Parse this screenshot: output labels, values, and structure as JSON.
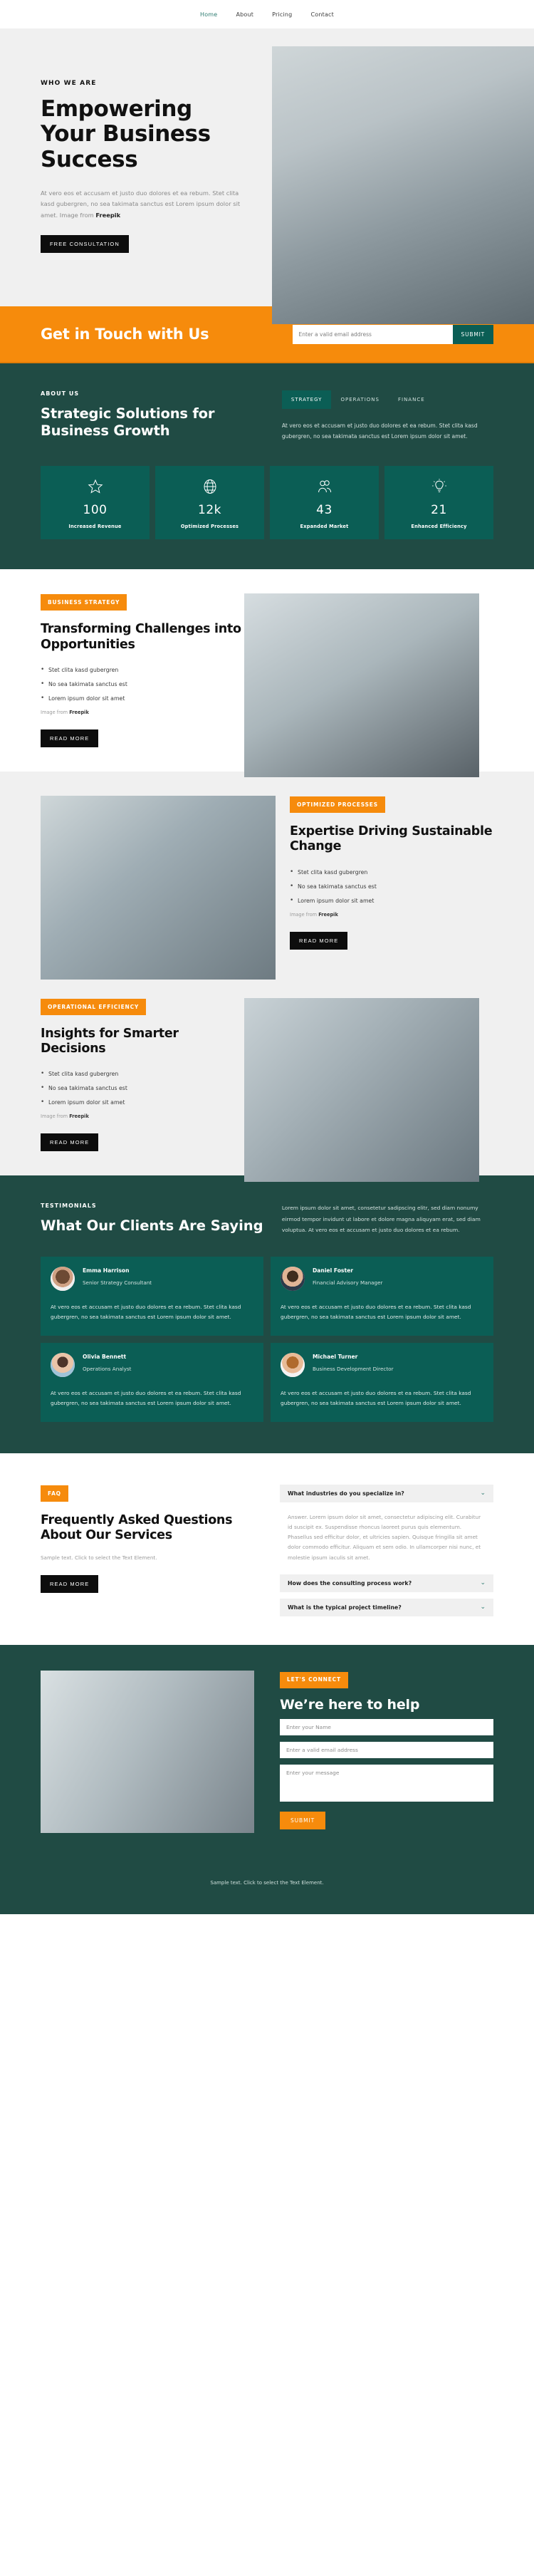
{
  "nav": {
    "items": [
      {
        "label": "Home",
        "active": true
      },
      {
        "label": "About",
        "active": false
      },
      {
        "label": "Pricing",
        "active": false
      },
      {
        "label": "Contact",
        "active": false
      }
    ]
  },
  "hero": {
    "eyebrow": "WHO WE ARE",
    "title": "Empowering Your Business Success",
    "paragraph": "At vero eos et accusam et justo duo dolores et ea rebum. Stet clita kasd gubergren, no sea takimata sanctus est Lorem ipsum dolor sit amet. Image from ",
    "paragraph_bold": "Freepik",
    "button": "FREE CONSULTATION"
  },
  "cta": {
    "heading": "Get in Touch with Us",
    "email_placeholder": "Enter a valid email address",
    "submit": "SUBMIT"
  },
  "about": {
    "eyebrow": "ABOUT US",
    "title": "Strategic Solutions for Business Growth",
    "tabs": [
      {
        "label": "STRATEGY",
        "active": true
      },
      {
        "label": "OPERATIONS",
        "active": false
      },
      {
        "label": "FINANCE",
        "active": false
      }
    ],
    "paragraph": "At vero eos et accusam et justo duo dolores et ea rebum. Stet clita kasd gubergren, no sea takimata sanctus est Lorem ipsum dolor sit amet.",
    "stats": [
      {
        "icon": "star-icon",
        "value": "100",
        "label": "Increased Revenue"
      },
      {
        "icon": "globe-icon",
        "value": "12k",
        "label": "Optimized Processes"
      },
      {
        "icon": "users-icon",
        "value": "43",
        "label": "Expanded Market"
      },
      {
        "icon": "lightbulb-icon",
        "value": "21",
        "label": "Enhanced Efficiency"
      }
    ]
  },
  "features": [
    {
      "badge": "BUSINESS STRATEGY",
      "title": "Transforming Challenges into Opportunities",
      "bullets": [
        "Stet clita kasd gubergren",
        "No sea takimata sanctus est",
        "Lorem ipsum dolor sit amet"
      ],
      "credit_prefix": "Image from ",
      "credit_bold": "Freepik",
      "button": "READ MORE"
    },
    {
      "badge": "OPTIMIZED PROCESSES",
      "title": "Expertise Driving Sustainable Change",
      "bullets": [
        "Stet clita kasd gubergren",
        "No sea takimata sanctus est",
        "Lorem ipsum dolor sit amet"
      ],
      "credit_prefix": "Image from ",
      "credit_bold": "Freepik",
      "button": "READ MORE"
    },
    {
      "badge": "OPERATIONAL EFFICIENCY",
      "title": "Insights for Smarter Decisions",
      "bullets": [
        "Stet clita kasd gubergren",
        "No sea takimata sanctus est",
        "Lorem ipsum dolor sit amet"
      ],
      "credit_prefix": "Image from ",
      "credit_bold": "Freepik",
      "button": "READ MORE"
    }
  ],
  "testimonials": {
    "eyebrow": "TESTIMONIALS",
    "title": "What Our Clients Are Saying",
    "intro": "Lorem ipsum dolor sit amet, consetetur sadipscing elitr, sed diam nonumy eirmod tempor invidunt ut labore et dolore magna aliquyam erat, sed diam voluptua. At vero eos et accusam et justo duo dolores et ea rebum.",
    "quote": "At vero eos et accusam et justo duo dolores et ea rebum. Stet clita kasd gubergren, no sea takimata sanctus est Lorem ipsum dolor sit amet.",
    "cards": [
      {
        "name": "Emma Harrison",
        "role": "Senior Strategy Consultant"
      },
      {
        "name": "Daniel Foster",
        "role": "Financial Advisory Manager"
      },
      {
        "name": "Olivia Bennett",
        "role": "Operations Analyst"
      },
      {
        "name": "Michael Turner",
        "role": "Business Development Director"
      }
    ]
  },
  "faq": {
    "badge": "FAQ",
    "title": "Frequently Asked Questions About Our Services",
    "sample": "Sample text. Click to select the Text Element.",
    "button": "READ MORE",
    "items": [
      {
        "question": "What industries do you specialize in?",
        "answer": "Answer. Lorem ipsum dolor sit amet, consectetur adipiscing elit. Curabitur id suscipit ex. Suspendisse rhoncus laoreet purus quis elementum. Phasellus sed efficitur dolor, et ultricies sapien. Quisque fringilla sit amet dolor commodo efficitur. Aliquam et sem odio. In ullamcorper nisi nunc, et molestie ipsum iaculis sit amet.",
        "open": true
      },
      {
        "question": "How does the consulting process work?",
        "answer": "",
        "open": false
      },
      {
        "question": "What is the typical project timeline?",
        "answer": "",
        "open": false
      }
    ]
  },
  "contact": {
    "badge": "LET'S CONNECT",
    "title": "We’re here to help",
    "name_placeholder": "Enter your Name",
    "email_placeholder": "Enter a valid email address",
    "message_placeholder": "Enter your message",
    "submit": "SUBMIT"
  },
  "footer": {
    "note": "Sample text. Click to select the Text Element."
  },
  "colors": {
    "orange": "#f68b0c",
    "dark_teal": "#204b44",
    "teal": "#0b5e55",
    "grey_bg": "#f0f0f0",
    "black": "#0d0d0d"
  }
}
